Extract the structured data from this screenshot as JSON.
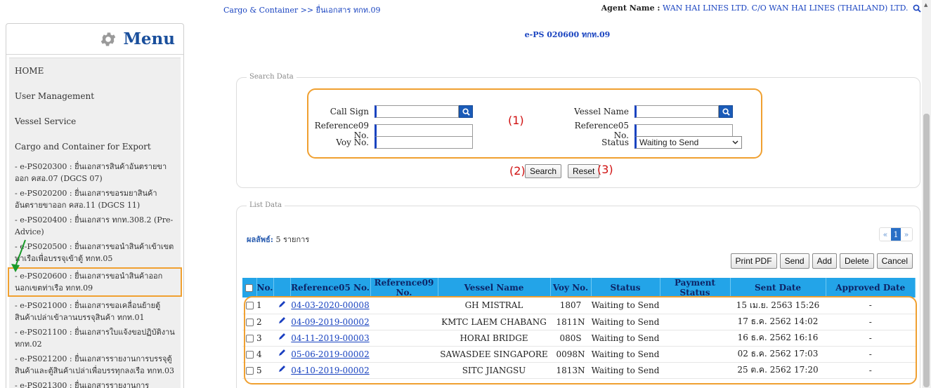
{
  "sidebar": {
    "title": "Menu",
    "items": [
      "HOME",
      "User Management",
      "Vessel Service",
      "Cargo and Container for Export"
    ],
    "subitems": [
      "- e-PS020300 : ยื่นเอกสารสินค้าอันตรายขาออก คสอ.07 (DGCS 07)",
      "- e-PS020200 : ยื่นเอกสารขอรมยาสินค้าอันตรายขาออก คสอ.11 (DGCS 11)",
      "- e-PS020400 : ยื่นเอกสาร ทกท.308.2 (Pre-Advice)",
      "- e-PS020500 : ยื่นเอกสารขอนำสินค้าเข้าเขตท่าเรือเพื่อบรรจุเข้าตู้ ทกท.05",
      "- e-PS020600 : ยื่นเอกสารขอนำสินค้าออกนอกเขตท่าเรือ ทกท.09",
      "- e-PS021000 : ยื่นเอกสารขอเคลื่อนย้ายตู้สินค้าเปล่าเข้าลานบรรจุสินค้า ทกท.01",
      "- e-PS021100 : ยื่นเอกสารใบแจ้งขอปฏิบัติงาน ทกท.02",
      "- e-PS021200 : ยื่นเอกสารรายงานการบรรจุตู้สินค้าและตู้สินค้าเปล่าเพื่อบรรทุกลงเรือ ทกท.03",
      "- e-PS021300 : ยื่นเอกสารรายงานการ"
    ]
  },
  "header": {
    "breadcrumb": "Cargo & Container >> ยื่นเอกสาร ทกท.09",
    "agent_label": "Agent Name :",
    "agent_value": "WAN HAI LINES LTD. C/O WAN HAI LINES (THAILAND) LTD.",
    "page_title": "e-PS 020600 ทกท.09"
  },
  "search": {
    "legend": "Search Data",
    "call_sign_label": "Call Sign",
    "vessel_name_label": "Vessel Name",
    "ref09_label": "Reference09 No.",
    "ref05_label": "Reference05 No.",
    "voy_label": "Voy No.",
    "status_label": "Status",
    "status_value": "Waiting to Send",
    "search_button": "Search",
    "reset_button": "Reset",
    "annot1": "(1)",
    "annot2": "(2)",
    "annot3": "(3)"
  },
  "list": {
    "legend": "List Data",
    "result_label": "ผลลัพธ์:",
    "result_count": "5 รายการ",
    "pager": {
      "prev": "«",
      "page": "1",
      "next": "»"
    },
    "buttons": [
      "Print PDF",
      "Send",
      "Add",
      "Delete",
      "Cancel"
    ],
    "columns": [
      "No.",
      "Reference05 No.",
      "Reference09 No.",
      "Vessel Name",
      "Voy No.",
      "Status",
      "Payment Status",
      "Sent Date",
      "Approved Date"
    ],
    "rows": [
      {
        "no": "1",
        "ref05": "04-03-2020-00008",
        "ref09": "",
        "vessel": "GH MISTRAL",
        "voy": "1807",
        "status": "Waiting to Send",
        "payment": "",
        "sent": "15 เม.ย. 2563 15:26",
        "approved": "-"
      },
      {
        "no": "2",
        "ref05": "04-09-2019-00002",
        "ref09": "",
        "vessel": "KMTC LAEM CHABANG",
        "voy": "1811N",
        "status": "Waiting to Send",
        "payment": "",
        "sent": "17 ธ.ค. 2562 14:02",
        "approved": "-"
      },
      {
        "no": "3",
        "ref05": "04-11-2019-00003",
        "ref09": "",
        "vessel": "HORAI BRIDGE",
        "voy": "080S",
        "status": "Waiting to Send",
        "payment": "",
        "sent": "16 ธ.ค. 2562 16:16",
        "approved": "-"
      },
      {
        "no": "4",
        "ref05": "05-06-2019-00002",
        "ref09": "",
        "vessel": "SAWASDEE SINGAPORE",
        "voy": "0098N",
        "status": "Waiting to Send",
        "payment": "",
        "sent": "02 ธ.ค. 2562 17:03",
        "approved": "-"
      },
      {
        "no": "5",
        "ref05": "04-10-2019-00002",
        "ref09": "",
        "vessel": "SITC JIANGSU",
        "voy": "1813N",
        "status": "Waiting to Send",
        "payment": "",
        "sent": "25 ต.ค. 2562 17:20",
        "approved": "-"
      }
    ]
  },
  "colors": {
    "accent": "#1a44c0",
    "header_bg": "#23a4e8",
    "highlight": "#f0a030",
    "annotation": "#d01010"
  }
}
